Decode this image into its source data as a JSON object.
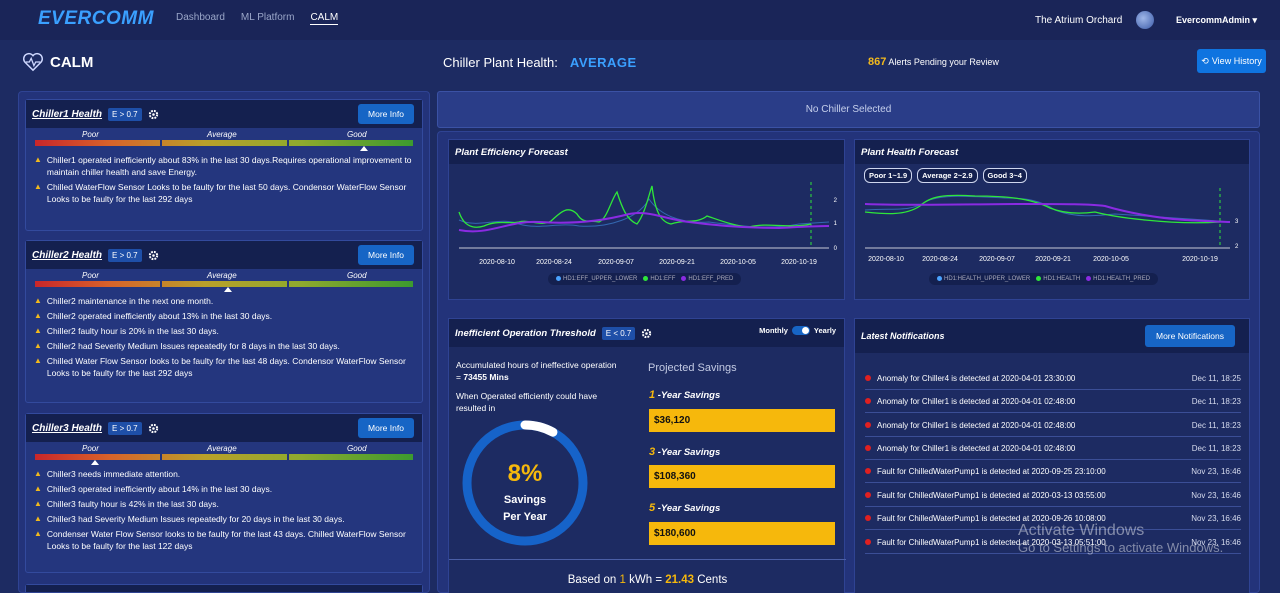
{
  "nav": {
    "logo": "EVERCOMM",
    "links": [
      "Dashboard",
      "ML Platform",
      "CALM"
    ],
    "site": "The Atrium Orchard",
    "user": "EvercommAdmin"
  },
  "header": {
    "page_title": "CALM",
    "plant_health_label": "Chiller Plant Health:",
    "plant_health_value": "AVERAGE",
    "alerts_count": "867",
    "alerts_text": "Alerts Pending your Review",
    "view_history": "View History"
  },
  "chillers": [
    {
      "title": "Chiller1 Health",
      "badge": "E > 0.7",
      "more": "More Info",
      "scale": [
        "Poor",
        "Average",
        "Good"
      ],
      "marker_fraction": 0.87,
      "messages": [
        "Chiller1 operated inefficiently about 83% in the last 30 days.Requires operational improvement to maintain chiller health and save Energy.",
        "Chilled WaterFlow Sensor Looks to be faulty for the last 50 days. Condensor WaterFlow Sensor Looks to be faulty for the last 292 days"
      ]
    },
    {
      "title": "Chiller2 Health",
      "badge": "E > 0.7",
      "more": "More Info",
      "scale": [
        "Poor",
        "Average",
        "Good"
      ],
      "marker_fraction": 0.51,
      "messages": [
        "Chiller2 maintenance in the next one month.",
        "Chiller2 operated inefficiently about 13% in the last 30 days.",
        "Chiller2 faulty hour is 20% in the last 30 days.",
        "Chiller2 had Severity Medium Issues repeatedly for 8 days in the last 30 days.",
        "Chilled Water Flow Sensor looks to be faulty for the last 48 days. Condensor WaterFlow Sensor Looks to be faulty for the last 292 days"
      ]
    },
    {
      "title": "Chiller3 Health",
      "badge": "E > 0.7",
      "more": "More Info",
      "scale": [
        "Poor",
        "Average",
        "Good"
      ],
      "marker_fraction": 0.16,
      "messages": [
        "Chiller3 needs immediate attention.",
        "Chiller3 operated inefficiently about 14% in the last 30 days.",
        "Chiller3 faulty hour is 42% in the last 30 days.",
        "Chiller3 had Severity Medium Issues repeatedly for 20 days in the last 30 days.",
        "Condenser Water Flow Sensor looks to be faulty for the last 43 days. Chilled WaterFlow Sensor Looks to be faulty for the last 122 days"
      ]
    }
  ],
  "no_chiller": "No Chiller Selected",
  "efficiency_forecast": {
    "title": "Plant Efficiency Forecast",
    "x_ticks": [
      "2020-08-10",
      "2020-08-24",
      "2020-09-07",
      "2020-09-21",
      "2020-10-05",
      "2020-10-19"
    ],
    "y_ticks": [
      "2",
      "1",
      "0"
    ],
    "legend": [
      "HD1:EFF_UPPER_LOWER",
      "HD1:EFF",
      "HD1:EFF_PRED"
    ]
  },
  "health_forecast": {
    "title": "Plant Health Forecast",
    "pills": [
      "Poor 1~1.9",
      "Average 2~2.9",
      "Good 3~4"
    ],
    "x_ticks": [
      "2020-08-10",
      "2020-08-24",
      "2020-09-07",
      "2020-09-21",
      "2020-10-05",
      "2020-10-19"
    ],
    "y_ticks": [
      "3",
      "2"
    ],
    "legend": [
      "HD1:HEALTH_UPPER_LOWER",
      "HD1:HEALTH",
      "HD1:HEALTH_PRED"
    ]
  },
  "threshold": {
    "title": "Inefficient Operation Threshold",
    "badge": "E < 0.7",
    "toggle_left": "Monthly",
    "toggle_right": "Yearly",
    "accum_label": "Accumulated hours of ineffective operation",
    "accum_prefix": "= ",
    "accum_value": "73455 Mins",
    "operated_text": "When Operated efficiently could have resulted in",
    "percent": "8%",
    "percent_fraction": 0.08,
    "savings_line1": "Savings",
    "savings_line2": "Per Year",
    "projected": "Projected Savings",
    "years": [
      {
        "n": "1",
        "label": " -Year Savings",
        "value": "$36,120"
      },
      {
        "n": "3",
        "label": " -Year Savings",
        "value": "$108,360"
      },
      {
        "n": "5",
        "label": " -Year Savings",
        "value": "$180,600"
      }
    ],
    "based_on": "Based on",
    "based_n": "1",
    "based_unit": "kWh",
    "based_eq": "=",
    "based_value": "21.43",
    "based_cents": "Cents"
  },
  "notifications": {
    "title": "Latest Notifications",
    "more": "More Notifications",
    "items": [
      {
        "text": "Anomaly for Chiller4 is detected at 2020-04-01 23:30:00",
        "time": "Dec 11, 18:25"
      },
      {
        "text": "Anomaly for Chiller1 is detected at 2020-04-01 02:48:00",
        "time": "Dec 11, 18:23"
      },
      {
        "text": "Anomaly for Chiller1 is detected at 2020-04-01 02:48:00",
        "time": "Dec 11, 18:23"
      },
      {
        "text": "Anomaly for Chiller1 is detected at 2020-04-01 02:48:00",
        "time": "Dec 11, 18:23"
      },
      {
        "text": "Fault for ChilledWaterPump1 is detected at 2020-09-25 23:10:00",
        "time": "Nov 23, 16:46"
      },
      {
        "text": "Fault for ChilledWaterPump1 is detected at 2020-03-13 03:55:00",
        "time": "Nov 23, 16:46"
      },
      {
        "text": "Fault for ChilledWaterPump1 is detected at 2020-09-26 10:08:00",
        "time": "Nov 23, 16:46"
      },
      {
        "text": "Fault for ChilledWaterPump1 is detected at 2020-03-13 05:51:00",
        "time": "Nov 23, 16:46"
      }
    ]
  },
  "watermark": {
    "line1": "Activate Windows",
    "line2": "Go to Settings to activate Windows."
  },
  "colors": {
    "accent": "#3aa0ff",
    "savings": "#f6b80c",
    "alert": "#e02020",
    "eff": "#2ee63a",
    "pred": "#8a2be2",
    "bound": "#4aa3ff"
  }
}
